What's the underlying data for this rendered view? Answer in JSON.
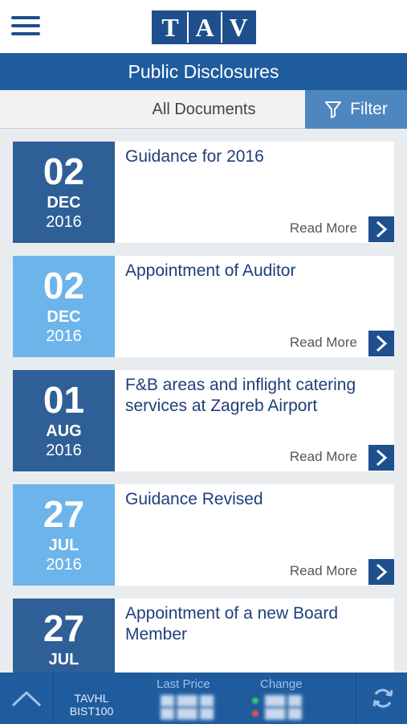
{
  "header": {
    "logo_letters": [
      "T",
      "A",
      "V"
    ],
    "menu_icon": "hamburger-icon"
  },
  "title": "Public Disclosures",
  "filterbar": {
    "all_documents": "All Documents",
    "filter_label": "Filter",
    "filter_icon": "funnel-icon"
  },
  "colors": {
    "brand_dark": "#1f5c9e",
    "date_dark": "#2f5f97",
    "date_light": "#6db4ea",
    "filter_bg": "#4e86bf"
  },
  "disclosures": [
    {
      "day": "02",
      "month": "DEC",
      "year": "2016",
      "title": "Guidance for 2016",
      "read_more": "Read More"
    },
    {
      "day": "02",
      "month": "DEC",
      "year": "2016",
      "title": "Appointment of Auditor",
      "read_more": "Read More"
    },
    {
      "day": "01",
      "month": "AUG",
      "year": "2016",
      "title": "F&B areas and inflight catering services at Zagreb Airport",
      "read_more": "Read More"
    },
    {
      "day": "27",
      "month": "JUL",
      "year": "2016",
      "title": "Guidance Revised",
      "read_more": "Read More"
    },
    {
      "day": "27",
      "month": "JUL",
      "year": "",
      "title": "Appointment of a new Board Member",
      "read_more": ""
    }
  ],
  "ticker": {
    "symbols": [
      "TAVHL",
      "BIST100"
    ],
    "last_price_label": "Last Price",
    "change_label": "Change",
    "up_icon": "chevron-up-icon",
    "refresh_icon": "refresh-icon"
  }
}
